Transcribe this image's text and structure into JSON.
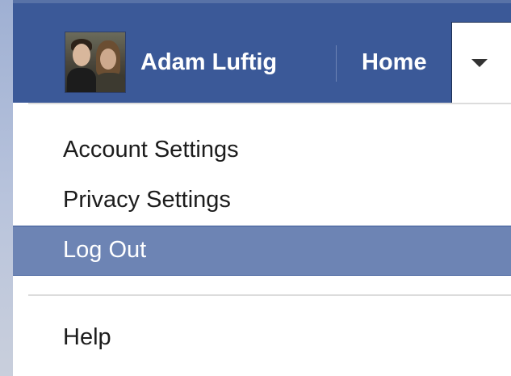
{
  "header": {
    "user_name": "Adam Luftig",
    "home_label": "Home",
    "avatar_icon": "profile-photo",
    "dropdown_icon": "caret-down-icon",
    "bar_color": "#3b5998"
  },
  "menu": {
    "items": [
      {
        "label": "Account Settings",
        "selected": false
      },
      {
        "label": "Privacy Settings",
        "selected": false
      },
      {
        "label": "Log Out",
        "selected": true
      },
      {
        "label": "Help",
        "selected": false
      }
    ],
    "highlight_color": "#6d84b4"
  }
}
